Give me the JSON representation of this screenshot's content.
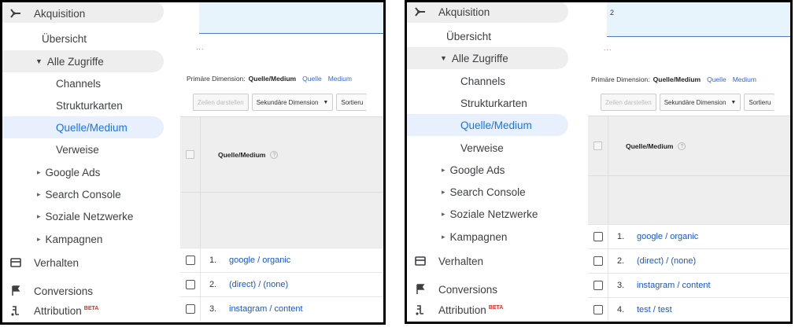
{
  "left": {
    "sidebar": {
      "acquisition": "Akquisition",
      "overview": "Übersicht",
      "all_traffic": "Alle Zugriffe",
      "sub_items": [
        "Channels",
        "Strukturkarten",
        "Quelle/Medium",
        "Verweise"
      ],
      "groups": [
        "Google Ads",
        "Search Console",
        "Soziale Netzwerke",
        "Kampagnen"
      ],
      "behavior": "Verhalten",
      "conversions": "Conversions",
      "attribution": "Attribution",
      "beta": "BETA"
    },
    "content": {
      "chart_value": "",
      "ellipsis": "...",
      "primary_dimension_label": "Primäre Dimension:",
      "primary_dimension_active": "Quelle/Medium",
      "dim_links": [
        "Quelle",
        "Medium"
      ],
      "btn_rows": "Zeilen darstellen",
      "btn_secondary": "Sekundäre Dimension",
      "btn_sort": "Sortieru",
      "col_header": "Quelle/Medium",
      "rows": [
        {
          "num": "1.",
          "source": "google / organic"
        },
        {
          "num": "2.",
          "source": "(direct) / (none)"
        },
        {
          "num": "3.",
          "source": "instagram / content"
        }
      ]
    }
  },
  "right": {
    "sidebar": {
      "acquisition": "Akquisition",
      "overview": "Übersicht",
      "all_traffic": "Alle Zugriffe",
      "sub_items": [
        "Channels",
        "Strukturkarten",
        "Quelle/Medium",
        "Verweise"
      ],
      "groups": [
        "Google Ads",
        "Search Console",
        "Soziale Netzwerke",
        "Kampagnen"
      ],
      "behavior": "Verhalten",
      "conversions": "Conversions",
      "attribution": "Attribution",
      "beta": "BETA"
    },
    "content": {
      "chart_value": "2",
      "ellipsis": "...",
      "primary_dimension_label": "Primäre Dimension:",
      "primary_dimension_active": "Quelle/Medium",
      "dim_links": [
        "Quelle",
        "Medium"
      ],
      "btn_rows": "Zeilen darstellen",
      "btn_secondary": "Sekundäre Dimension",
      "btn_sort": "Sortieru",
      "col_header": "Quelle/Medium",
      "rows": [
        {
          "num": "1.",
          "source": "google / organic"
        },
        {
          "num": "2.",
          "source": "(direct) / (none)"
        },
        {
          "num": "3.",
          "source": "instagram / content"
        },
        {
          "num": "4.",
          "source": "test / test"
        }
      ]
    }
  },
  "icons": {
    "acquisition": "acquisition-icon",
    "behavior": "behavior-icon",
    "conversions": "flag-icon",
    "attribution": "attribution-icon",
    "help": "help-icon",
    "dropdown": "triangle-down-icon",
    "expand": "chevron-right-icon"
  },
  "colors": {
    "active_text": "#1a73e8",
    "active_bg": "#e8f0fe",
    "pill_bg": "#eeeeee",
    "link": "#1a56c8"
  }
}
